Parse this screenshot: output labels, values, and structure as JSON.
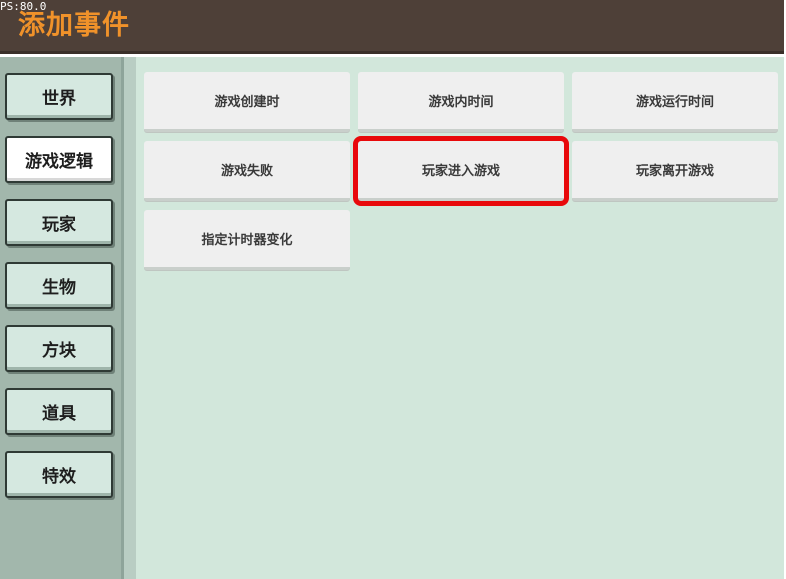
{
  "header": {
    "fps_text": "PS:80.0",
    "title": "添加事件"
  },
  "sidebar": {
    "items": [
      {
        "label": "世界",
        "active": false
      },
      {
        "label": "游戏逻辑",
        "active": true
      },
      {
        "label": "玩家",
        "active": false
      },
      {
        "label": "生物",
        "active": false
      },
      {
        "label": "方块",
        "active": false
      },
      {
        "label": "道具",
        "active": false
      },
      {
        "label": "特效",
        "active": false
      }
    ]
  },
  "events": {
    "items": [
      {
        "label": "游戏创建时"
      },
      {
        "label": "游戏内时间"
      },
      {
        "label": "游戏运行时间"
      },
      {
        "label": "游戏失败"
      },
      {
        "label": "玩家进入游戏",
        "highlighted": true
      },
      {
        "label": "玩家离开游戏"
      },
      {
        "label": "指定计时器变化"
      }
    ]
  },
  "colors": {
    "header_bg": "#4e4038",
    "title": "#f0922a",
    "sidebar_bg": "#a2b7ac",
    "content_bg": "#d2e7db",
    "highlight": "#e8090b"
  }
}
